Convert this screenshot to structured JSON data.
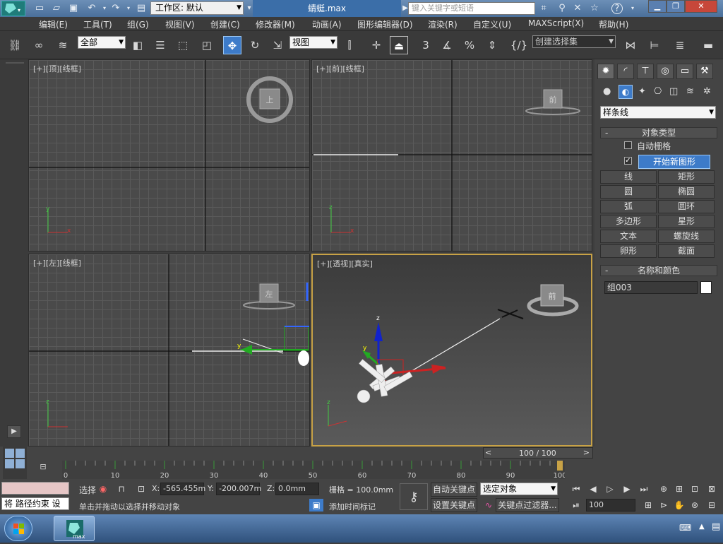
{
  "titlebar": {
    "document_title": "蜻蜓.max",
    "workspace_label": "工作区: 默认",
    "search_placeholder": "键入关键字或短语"
  },
  "menubar": {
    "items": [
      "编辑(E)",
      "工具(T)",
      "组(G)",
      "视图(V)",
      "创建(C)",
      "修改器(M)",
      "动画(A)",
      "图形编辑器(D)",
      "渲染(R)",
      "自定义(U)",
      "MAXScript(X)",
      "帮助(H)"
    ]
  },
  "toolbar": {
    "filter_select": "全部",
    "refcoord_select": "视图",
    "snap_label": "3",
    "named_selection_placeholder": "创建选择集"
  },
  "viewports": {
    "top": {
      "label": "[+][顶][线框]",
      "cube_label": "上"
    },
    "front": {
      "label": "[+][前][线框]",
      "cube_label": "前"
    },
    "left": {
      "label": "[+][左][线框]",
      "cube_label": "左"
    },
    "perspective": {
      "label": "[+][透视][真实]",
      "cube_label": "前"
    }
  },
  "command_panel": {
    "category_select": "样条线",
    "object_type_title": "对象类型",
    "autogrid_label": "自动栅格",
    "autogrid_checked": false,
    "start_new_shape_label": "开始新图形",
    "start_new_shape_checked": true,
    "buttons": [
      "线",
      "矩形",
      "圆",
      "椭圆",
      "弧",
      "圆环",
      "多边形",
      "星形",
      "文本",
      "螺旋线",
      "卵形",
      "截面"
    ],
    "name_color_title": "名称和颜色",
    "object_name": "组003",
    "object_color": "#ffffff"
  },
  "timeline": {
    "frame_display": "100 / 100",
    "current_frame": 100,
    "tick_labels": [
      "0",
      "10",
      "20",
      "30",
      "40",
      "50",
      "60",
      "70",
      "80",
      "90",
      "100"
    ]
  },
  "status": {
    "maxscript_listener": "将 路径约束 设",
    "select_label": "选择",
    "prompt": "单击并拖动以选择并移动对象",
    "x_label": "X:",
    "x_value": "-565.455m",
    "y_label": "Y:",
    "y_value": "-200.007m",
    "z_label": "Z:",
    "z_value": "0.0mm",
    "grid_label": "栅格 = 100.0mm",
    "add_time_tag": "添加时间标记",
    "auto_key": "自动关键点",
    "set_key": "设置关键点",
    "key_filter_select": "选定对象",
    "key_filters_button": "关键点过滤器...",
    "frame_field": "100"
  },
  "taskbar": {
    "app_label": "max"
  },
  "colors": {
    "accent": "#3d7bc9",
    "active_viewport_border": "#c8a246"
  }
}
